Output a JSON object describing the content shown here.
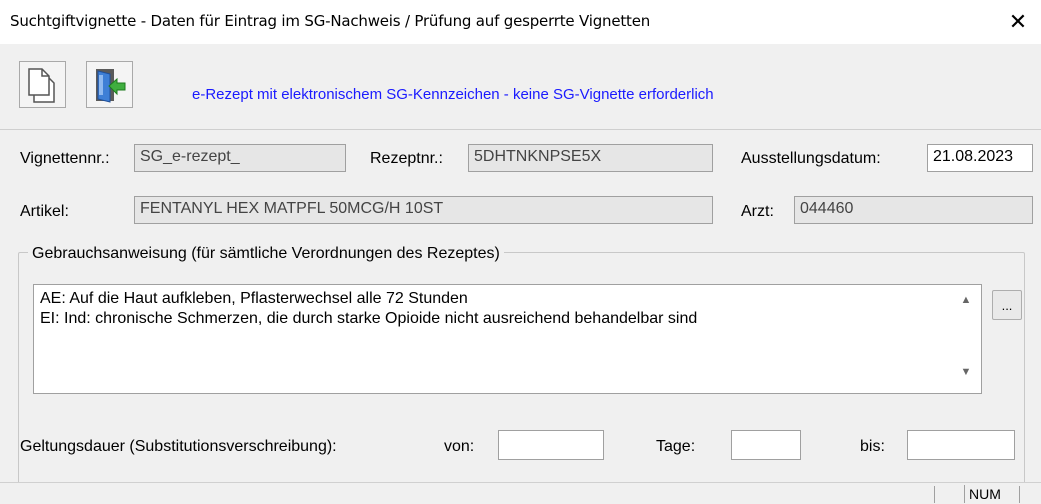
{
  "window": {
    "title": "Suchtgiftvignette - Daten für Eintrag im SG-Nachweis / Prüfung auf gesperrte Vignetten",
    "close_glyph": "✕"
  },
  "toolbar": {
    "message": "e-Rezept mit elektronischem SG-Kennzeichen - keine SG-Vignette erforderlich",
    "message_color": "#1a1aff",
    "buttons": [
      "new-document-icon",
      "exit-door-icon"
    ]
  },
  "form": {
    "vignette_label": "Vignettennr.:",
    "vignette_value": "SG_e-rezept_",
    "rezept_label": "Rezeptnr.:",
    "rezept_value": "5DHTNKNPSE5X",
    "datum_label": "Ausstellungsdatum:",
    "datum_value": "21.08.2023",
    "artikel_label": "Artikel:",
    "artikel_value": "FENTANYL HEX MATPFL  50MCG/H 10ST",
    "arzt_label": "Arzt:",
    "arzt_value": "044460"
  },
  "usage": {
    "legend": "Gebrauchsanweisung (für sämtliche Verordnungen des Rezeptes)",
    "line1": "AE: Auf die Haut aufkleben, Pflasterwechsel alle 72 Stunden",
    "line2": "EI: Ind: chronische Schmerzen, die durch starke Opioide nicht ausreichend behandelbar sind",
    "more_button": "..."
  },
  "validity": {
    "label": "Geltungsdauer (Substitutionsverschreibung):",
    "von_label": "von:",
    "von_value": "",
    "tage_label": "Tage:",
    "tage_value": "",
    "bis_label": "bis:",
    "bis_value": ""
  },
  "statusbar": {
    "num": "NUM"
  }
}
